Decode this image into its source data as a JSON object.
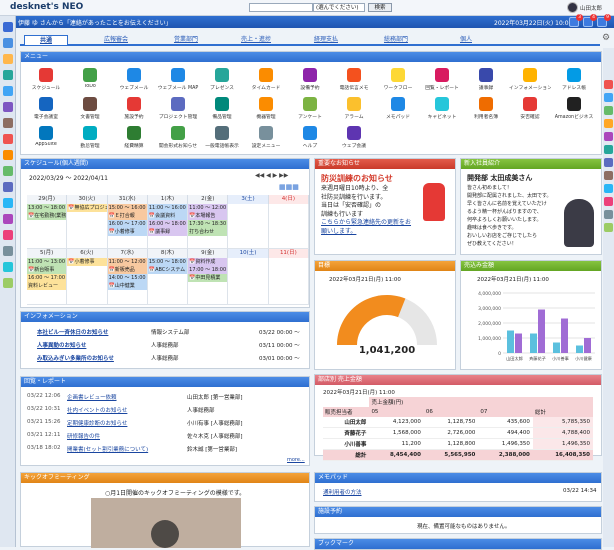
{
  "app": {
    "logo": "desknet's NEO",
    "logo_sub": "desknet's"
  },
  "topbar": {
    "search_placeholder": "",
    "select_value": "(選んでください)",
    "search_button": "検索",
    "user_name": "山田太郎"
  },
  "infobar": {
    "message": "伊藤 ゆ さんから「連絡があったことをお伝えください」",
    "date": "2022年03月22日(火) 10:00"
  },
  "badges": [
    "3",
    "4",
    "9"
  ],
  "tabs": [
    "共通",
    "広報審会",
    "営業部門",
    "売上・進捗",
    "経理支払",
    "総務部門",
    "個人"
  ],
  "menu": {
    "title": "メニュー",
    "items": [
      "スケジュール",
      "ToDo",
      "ウェブメール",
      "ウェブメール MAP",
      "プレゼンス",
      "タイムカード",
      "設備予約",
      "電話伝言メモ",
      "ワークフロー",
      "回覧・レポート",
      "議事録",
      "インフォメーション",
      "アドレス帳",
      "電子会議室",
      "文書管理",
      "施設予約",
      "プロジェクト管理",
      "備品管理",
      "機器管理",
      "アンケート",
      "アラーム",
      "メモパッド",
      "キャビネット",
      "利用者名簿",
      "安否確認",
      "Amazonビジネス",
      "AppSuite",
      "勤怠管理",
      "経費精算",
      "開会形式お知らせ",
      "一般電話帳表示",
      "設定メニュー",
      "ヘルプ",
      "ウェブ会議"
    ]
  },
  "schedule": {
    "title": "スケジュール(個人週間)",
    "range": "2022/03/29 ～ 2022/04/11",
    "week1": {
      "days": [
        "29(月)",
        "30(火)",
        "31(水)",
        "1(木)",
        "2(金)",
        "3(土)",
        "4(日)"
      ],
      "events": [
        [
          "13:00 ～ 18:00",
          "📅在宅勤務(業務)"
        ],
        [
          "📅無協広プロジェクト"
        ],
        [
          "15:00 ～ 16:00",
          "📅Ｅ打合報",
          "16:00 ～ 17:00",
          "📅小着修事"
        ],
        [
          "11:00 ～ 16:00",
          "📅会議資料",
          "16:00 ～ 18:00",
          "📅議事録"
        ],
        [
          "11:00 ～ 12:00",
          "📅本場報告",
          "17:30 ～ 18:30",
          "打ち合わせ"
        ],
        [],
        []
      ]
    },
    "week2": {
      "days": [
        "5(月)",
        "6(火)",
        "7(水)",
        "8(木)",
        "9(金)",
        "10(土)",
        "11(日)"
      ],
      "events": [
        [
          "11:00 ～ 13:00",
          "📅新台販事",
          "16:00 ～ 17:00",
          "資料レビュー"
        ],
        [
          "📅小着修事"
        ],
        [
          "11:00 ～ 12:00",
          "📅新販売品",
          "14:00 ～ 15:00",
          "📅山中健業"
        ],
        [
          "15:00 ～ 18:00",
          "📅ABCシステム"
        ],
        [
          "📅資料作成",
          "17:00 ～ 18:00",
          "📅中田見積業"
        ],
        [],
        []
      ]
    }
  },
  "information": {
    "title": "インフォメーション",
    "rows": [
      {
        "title": "本社ビル一斉休日のお知らせ",
        "from": "情報システム部",
        "date": "03/22 00:00 ～"
      },
      {
        "title": "人事異動のお知らせ",
        "from": "人事総務部",
        "date": "03/11 00:00 ～"
      },
      {
        "title": "み取込みぎい多業所のお知らせ",
        "from": "人事総務部",
        "date": "03/01 00:00 ～"
      }
    ]
  },
  "report": {
    "title": "回覧・レポート",
    "rows": [
      {
        "date": "03/22 12:06",
        "title": "企画書レビュー依頼",
        "from": "山田太郎 [第一営業部]"
      },
      {
        "date": "03/22 10:31",
        "title": "社内イベントのお知らせ",
        "from": "人事総務部"
      },
      {
        "date": "03/21 15:26",
        "title": "定期健康診断のお知らせ",
        "from": "小川有事 [人事総務部]"
      },
      {
        "date": "03/21 12:11",
        "title": "研修報告の件",
        "from": "佐々木克 [人事総務部]"
      },
      {
        "date": "03/18 18:02",
        "title": "開業書(セット割引業務について)",
        "from": "鈴木誠 [第一営業部]"
      }
    ],
    "more": "more..."
  },
  "kickoff": {
    "title": "キックオフミーティング",
    "caption": "○月1日開催のキックオフミーティングの模様です。"
  },
  "notice": {
    "title": "重要なお知らせ",
    "heading": "防災訓練のお知らせ",
    "lines": [
      "来週月曜日10時より、全",
      "社防災訓練を行います。",
      "当日は「安否確認」の",
      "訓練も行います",
      "こちらから緊急連絡先の更新をお願いします。"
    ],
    "link": "こちら"
  },
  "newcomer": {
    "title": "新入社員紹介",
    "name": "開発部 太田成美さん",
    "lines": [
      "皆さん初めまして！",
      "開発部に配属されました、太田です。",
      "早く皆さんに名前を覚えていただけ",
      "るよう精一杯がんばりますので、",
      "何卒よろしくお願いいたします。",
      "趣味は食べ歩きです。",
      "おいしいお店をご存じでしたら",
      "ぜひ教えてください！"
    ]
  },
  "gauge": {
    "title": "目標",
    "caption": "2022年03月21日(月) 11:00",
    "value": "1,041,200",
    "fraction": 0.62
  },
  "sales_chart": {
    "title": "売込み金額",
    "caption": "2022年03月21日(月) 11:00",
    "chart_data": {
      "type": "bar",
      "categories": [
        "山田太郎",
        "斉藤花子",
        "小川善事",
        "小川健康"
      ],
      "series": [
        {
          "values": [
            1500000,
            1300000,
            700000,
            500000
          ],
          "color": "#5bc0de"
        },
        {
          "values": [
            1300000,
            2900000,
            2300000,
            1000000
          ],
          "color": "#a06cd5"
        }
      ],
      "yticks": [
        "0",
        "1,000,000",
        "2,000,000",
        "3,000,000",
        "4,000,000"
      ],
      "ylim": [
        0,
        4000000
      ]
    }
  },
  "sales_table": {
    "title": "部店別 売上金額",
    "caption": "2022年03月21日(月) 11:00",
    "header_top": "売上金額(円)",
    "row_label": "販売担当者",
    "months": [
      "05",
      "06",
      "07",
      "総計"
    ],
    "rows": [
      {
        "name": "山田太郎",
        "v": [
          "4,123,000",
          "1,128,750",
          "435,600",
          "5,785,350"
        ]
      },
      {
        "name": "斉藤花子",
        "v": [
          "1,568,000",
          "2,726,000",
          "494,400",
          "4,788,400"
        ]
      },
      {
        "name": "小川善事",
        "v": [
          "11,200",
          "1,128,800",
          "1,496,350",
          "1,496,350"
        ]
      },
      {
        "name": "総計",
        "v": [
          "8,454,400",
          "5,565,950",
          "2,388,000",
          "16,408,350"
        ]
      }
    ]
  },
  "memopad": {
    "title": "メモパッド",
    "item": "通利用者の方法",
    "date": "03/22 14:34"
  },
  "facility": {
    "title": "施設予約",
    "message": "現在、備置可能なものはありません。"
  },
  "bookmark": {
    "title": "ブックマーク"
  }
}
